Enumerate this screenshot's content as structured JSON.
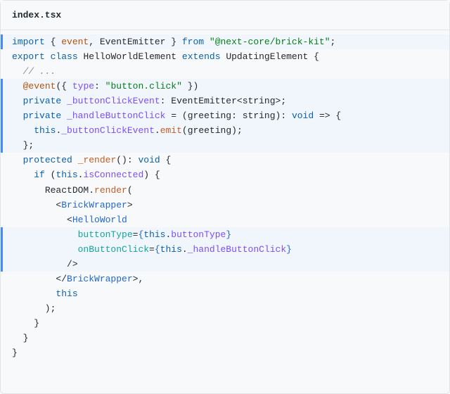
{
  "filename": "index.tsx",
  "lines": {
    "l01": "import { event, EventEmitter } from \"@next-core/brick-kit\";",
    "l02": "",
    "l03": "export class HelloWorldElement extends UpdatingElement {",
    "l04": "  // ...",
    "l05": "",
    "l06": "  @event({ type: \"button.click\" })",
    "l07": "  private _buttonClickEvent: EventEmitter<string>;",
    "l08": "",
    "l09": "  private _handleButtonClick = (greeting: string): void => {",
    "l10": "    this._buttonClickEvent.emit(greeting);",
    "l11": "  };",
    "l12": "",
    "l13": "  protected _render(): void {",
    "l14": "    if (this.isConnected) {",
    "l15": "      ReactDOM.render(",
    "l16": "        <BrickWrapper>",
    "l17": "          <HelloWorld",
    "l18": "            buttonType={this.buttonType}",
    "l19": "            onButtonClick={this._handleButtonClick}",
    "l20": "          />",
    "l21": "        </BrickWrapper>,",
    "l22": "        this",
    "l23": "      );",
    "l24": "    }",
    "l25": "  }",
    "l26": "}"
  },
  "tokens": {
    "kw_import": "import",
    "kw_from": "from",
    "kw_export": "export",
    "kw_class": "class",
    "kw_extends": "extends",
    "kw_private": "private",
    "kw_protected": "protected",
    "kw_void": "void",
    "kw_if": "if",
    "kw_this": "this",
    "decor_at": "@",
    "decor_event": "event",
    "ident_EventEmitter": "EventEmitter",
    "ident_HelloWorldElement": "HelloWorldElement",
    "ident_UpdatingElement": "UpdatingElement",
    "prop_type": "type",
    "prop_buttonClickEvent": "_buttonClickEvent",
    "prop_handleButtonClick": "_handleButtonClick",
    "prop_isConnected": "isConnected",
    "prop_buttonType": "buttonType",
    "fn_emit": "emit",
    "fn_render": "_render",
    "fn_reactdom_render": "render",
    "ident_ReactDOM": "ReactDOM",
    "ident_greeting": "greeting",
    "type_string": "string",
    "tag_BrickWrapper": "BrickWrapper",
    "tag_HelloWorld": "HelloWorld",
    "attr_buttonType": "buttonType",
    "attr_onButtonClick": "onButtonClick",
    "str_pkg": "\"@next-core/brick-kit\"",
    "str_btn": "\"button.click\"",
    "cmt_dots": "// ..."
  }
}
